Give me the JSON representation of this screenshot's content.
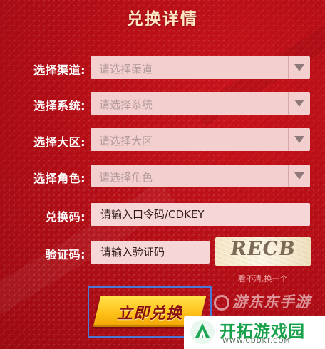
{
  "header": {
    "title": "兑换详情"
  },
  "form": {
    "channel": {
      "label": "选择渠道:",
      "placeholder": "请选择渠道"
    },
    "system": {
      "label": "选择系统:",
      "placeholder": "请选择系统"
    },
    "region": {
      "label": "选择大区:",
      "placeholder": "请选择大区"
    },
    "role": {
      "label": "选择角色:",
      "placeholder": "请选择角色"
    },
    "code": {
      "label": "兑换码:",
      "placeholder": "请输入口令码/CDKEY"
    },
    "captcha": {
      "label": "验证码:",
      "placeholder": "请输入验证码",
      "image_text": "RECB",
      "refresh_label": "看不清,换一个"
    }
  },
  "actions": {
    "redeem_label": "立即兑换"
  },
  "watermarks": {
    "overlay_text": "游东东手游",
    "badge_brand": "开拓游戏园",
    "badge_domain": "WWW.CDDKT.COM"
  },
  "colors": {
    "background": "#b50d16",
    "title": "#ffe6c4",
    "field_bg": "#f3cfcf",
    "button": "#ffc21a",
    "badge_green": "#17a14a"
  }
}
